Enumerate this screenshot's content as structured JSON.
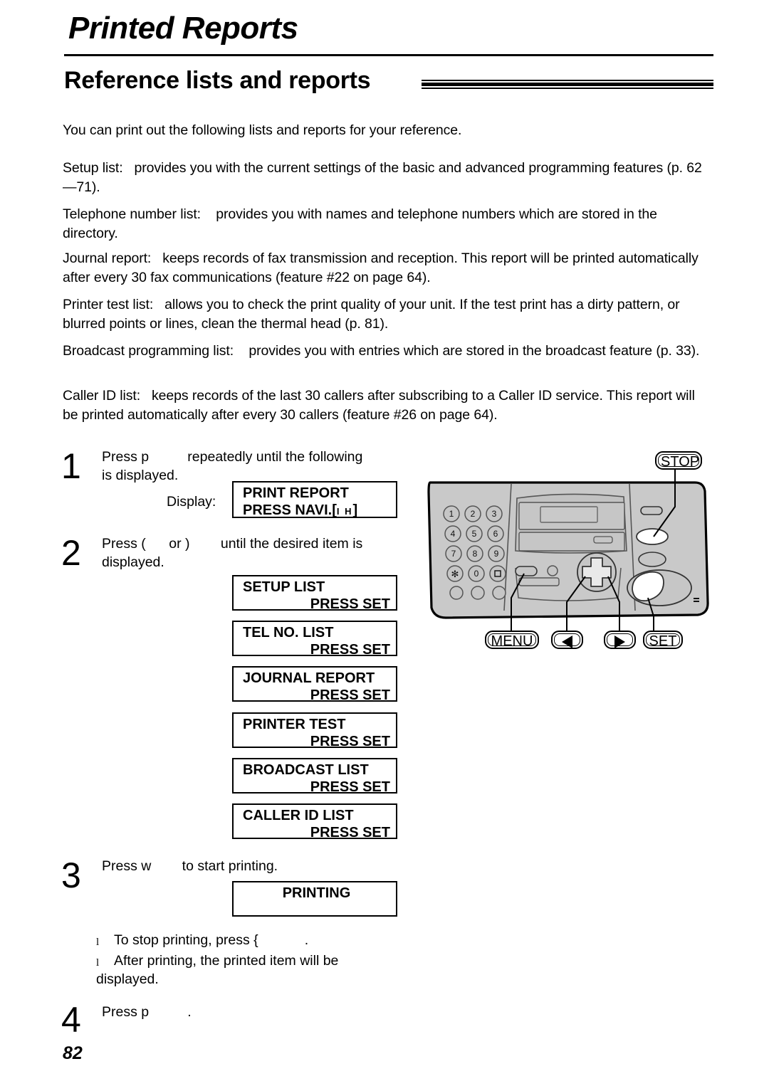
{
  "header": {
    "chapter_title": "Printed Reports",
    "section_title": "Reference lists and reports"
  },
  "intro": "You can print out the following lists and reports for your reference.",
  "descriptions": [
    {
      "label": "Setup list:",
      "text": "provides you with the current settings of the basic and advanced programming features (p. 62—71)."
    },
    {
      "label": "Telephone number list:",
      "text": "provides you with names and telephone numbers which are stored in the directory."
    },
    {
      "label": "Journal report:",
      "text": "keeps records of fax transmission and reception. This report will be printed automatically after every 30 fax communications (feature #22 on page 64)."
    },
    {
      "label": "Printer test list:",
      "text": "allows you to check the print quality of your unit. If the test print has a dirty pattern, or blurred points or lines, clean the thermal head (p. 81)."
    },
    {
      "label": "Broadcast programming list:",
      "text": "provides you with entries which are stored in the broadcast feature (p. 33)."
    },
    {
      "label": "Caller ID list:",
      "text": "keeps records of the last 30 callers after subscribing to a Caller ID service. This report will be printed automatically after every 30 callers (feature #26 on page 64)."
    }
  ],
  "steps": {
    "step1": {
      "number": "1",
      "text": "Press p          repeatedly until the following\nis displayed.",
      "display_label": "Display:"
    },
    "step2": {
      "number": "2",
      "text": "Press (      or )        until the desired item is\ndisplayed."
    },
    "step3": {
      "number": "3",
      "text": "Press w        to start printing."
    },
    "step4": {
      "number": "4",
      "text": "Press p          ."
    }
  },
  "lcd_screens": {
    "print_report": {
      "line1": "PRINT REPORT",
      "line2_main": "PRESS NAVI.[",
      "line2_arrows": "I H",
      "line2_end": "]"
    },
    "menu_items": [
      {
        "line1": "SETUP LIST",
        "line2": "PRESS SET"
      },
      {
        "line1": "TEL NO. LIST",
        "line2": "PRESS SET"
      },
      {
        "line1": "JOURNAL REPORT",
        "line2": "PRESS SET"
      },
      {
        "line1": "PRINTER TEST",
        "line2": "PRESS SET"
      },
      {
        "line1": "BROADCAST LIST",
        "line2": "PRESS SET"
      },
      {
        "line1": "CALLER ID LIST",
        "line2": "PRESS SET"
      }
    ],
    "printing": {
      "line1": "PRINTING",
      "line2": ""
    }
  },
  "notes": [
    "To stop printing, press {            .",
    "After printing, the printed item will be\ndisplayed."
  ],
  "diagram": {
    "callouts": {
      "stop": "STOP",
      "menu": "MENU",
      "set": "SET"
    },
    "keypad": [
      "1",
      "2",
      "3",
      "4",
      "5",
      "6",
      "7",
      "8",
      "9",
      "✻",
      "0",
      "▫"
    ],
    "colors": {
      "panel": "#c9c9c9",
      "panel_dark": "#bdbdbd",
      "outline": "#000000",
      "button_white": "#ffffff"
    }
  },
  "page_number": "82"
}
